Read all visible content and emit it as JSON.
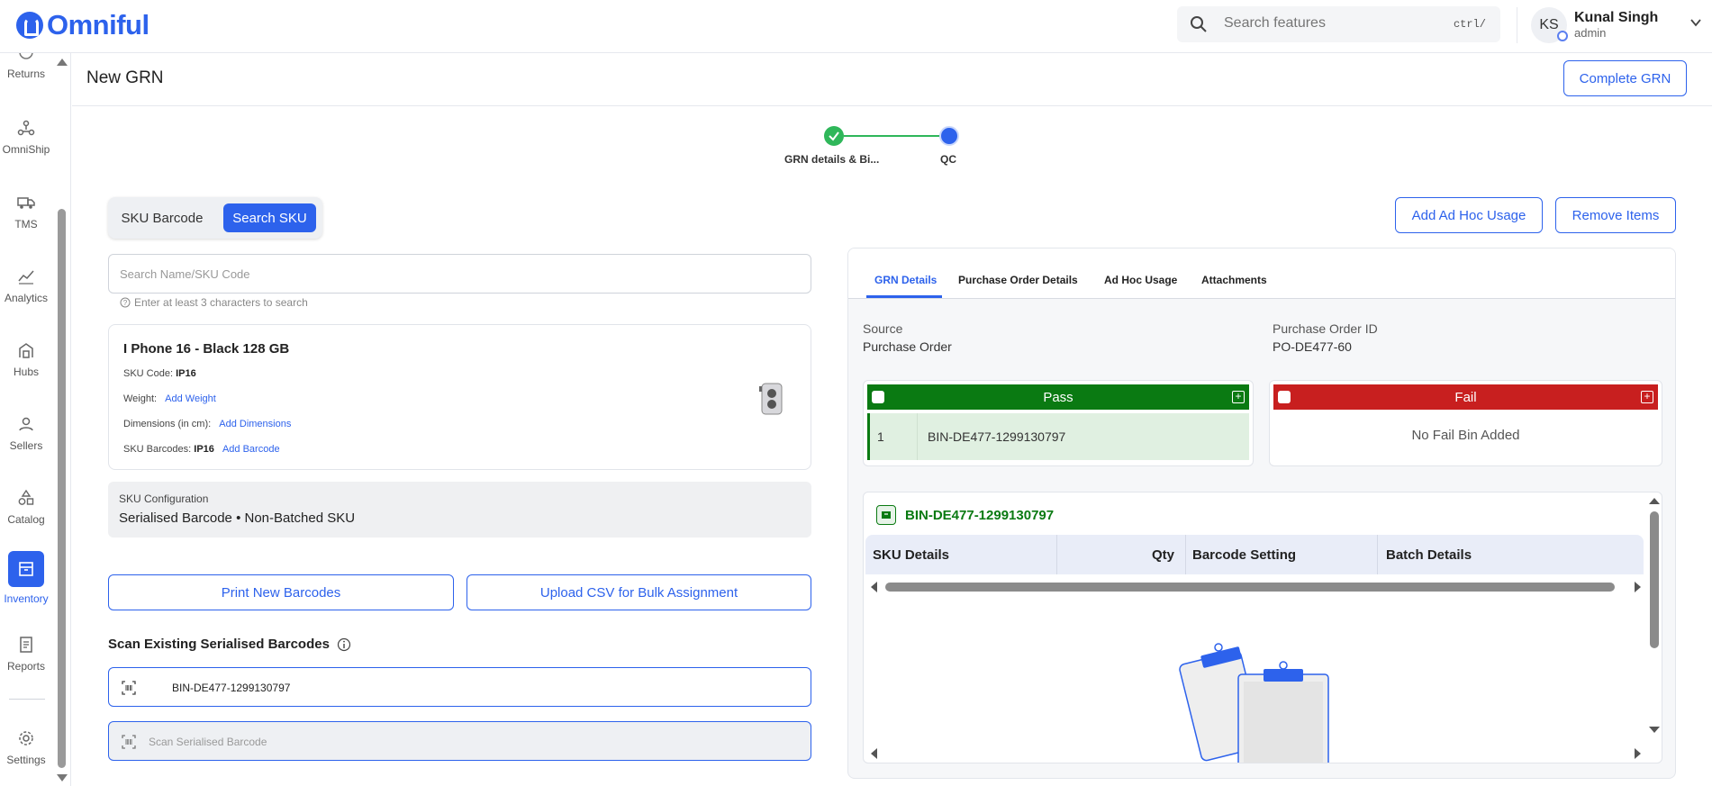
{
  "app": {
    "logo_text": "Omniful"
  },
  "topbar": {
    "search_placeholder": "Search features",
    "search_shortcut": "ctrl/",
    "avatar_initials": "KS",
    "user_name": "Kunal Singh",
    "user_role": "admin"
  },
  "sidebar": {
    "items": [
      {
        "label": "Returns",
        "icon": "returns-icon"
      },
      {
        "label": "OmniShip",
        "icon": "omniship-icon"
      },
      {
        "label": "TMS",
        "icon": "truck-icon"
      },
      {
        "label": "Analytics",
        "icon": "analytics-icon"
      },
      {
        "label": "Hubs",
        "icon": "hubs-icon"
      },
      {
        "label": "Sellers",
        "icon": "user-icon"
      },
      {
        "label": "Catalog",
        "icon": "catalog-icon"
      },
      {
        "label": "Inventory",
        "icon": "inventory-icon",
        "active": true
      },
      {
        "label": "Reports",
        "icon": "reports-icon"
      },
      {
        "label": "Settings",
        "icon": "gear-icon"
      }
    ]
  },
  "page": {
    "title": "New GRN",
    "complete_label": "Complete GRN"
  },
  "stepper": {
    "steps": [
      {
        "label": "GRN details & Bi...",
        "status": "done"
      },
      {
        "label": "QC",
        "status": "current"
      }
    ]
  },
  "left": {
    "toggle": {
      "option_a": "SKU Barcode",
      "option_b": "Search SKU"
    },
    "search_placeholder": "Search Name/SKU Code",
    "search_hint": "Enter at least 3 characters to search",
    "product": {
      "name": "I Phone 16 - Black 128 GB",
      "sku_code_label": "SKU Code:",
      "sku_code": "IP16",
      "weight_label": "Weight:",
      "weight_link": "Add Weight",
      "dimensions_label": "Dimensions (in cm):",
      "dimensions_link": "Add Dimensions",
      "barcodes_label": "SKU Barcodes:",
      "barcode_value": "IP16",
      "barcode_link": "Add Barcode"
    },
    "config": {
      "label": "SKU Configuration",
      "value": "Serialised Barcode  •  Non-Batched SKU"
    },
    "print_label": "Print New Barcodes",
    "upload_label": "Upload CSV for Bulk Assignment",
    "scan_title": "Scan Existing Serialised Barcodes",
    "scanned_value": "BIN-DE477-1299130797",
    "scan_placeholder": "Scan Serialised Barcode"
  },
  "right": {
    "adhoc_label": "Add Ad Hoc Usage",
    "remove_label": "Remove Items",
    "tabs": [
      "GRN Details",
      "Purchase Order Details",
      "Ad Hoc Usage",
      "Attachments"
    ],
    "active_tab": "GRN Details",
    "source_label": "Source",
    "source_value": "Purchase Order",
    "po_label": "Purchase Order ID",
    "po_value": "PO-DE477-60",
    "pass": {
      "title": "Pass",
      "row_num": "1",
      "row_bin": "BIN-DE477-1299130797"
    },
    "fail": {
      "title": "Fail",
      "empty": "No Fail Bin Added"
    },
    "bin_detail": {
      "title": "BIN-DE477-1299130797",
      "columns": [
        "SKU Details",
        "Qty",
        "Barcode Setting",
        "Batch Details"
      ]
    }
  },
  "colors": {
    "primary": "#2d62ec",
    "pass": "#0a7a12",
    "fail": "#c81f1f",
    "success": "#2fb75a"
  }
}
